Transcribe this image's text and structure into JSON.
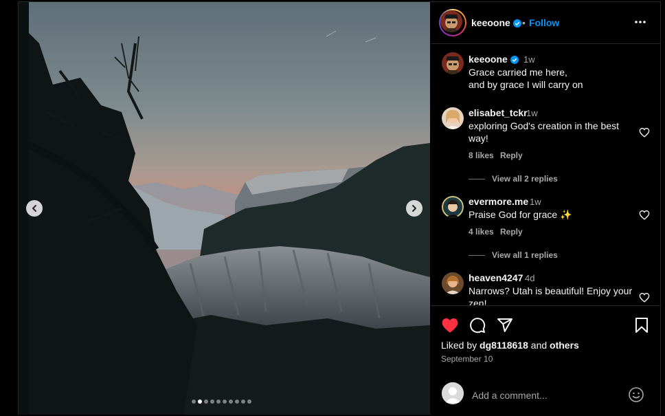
{
  "post": {
    "author": "keeoone",
    "follow_label": "Follow",
    "separator": "•",
    "image_count": 10,
    "image_index": 2
  },
  "caption": {
    "user": "keeoone",
    "time": "1w",
    "line1": "Grace carried me here,",
    "line2": "and by grace I will carry on"
  },
  "comments": [
    {
      "user": "elisabet_tckr",
      "time": "1w",
      "line1": "exploring God's creation in the best",
      "line2": "way!",
      "likes": "8 likes",
      "reply": "Reply",
      "view_replies": "View all 2 replies"
    },
    {
      "user": "evermore.me",
      "time": "1w",
      "line1": "Praise God for grace ✨",
      "likes": "4 likes",
      "reply": "Reply",
      "view_replies": "View all 1 replies"
    },
    {
      "user": "heaven4247",
      "time": "4d",
      "line1": "Narrows? Utah is beautiful! Enjoy your",
      "line2": "zen!"
    }
  ],
  "likes": {
    "prefix": "Liked by",
    "user": "dg8118618",
    "conj": "and",
    "others": "others"
  },
  "date": "September 10",
  "add_comment": {
    "placeholder": "Add a comment..."
  },
  "colors": {
    "accent": "#0095f6",
    "like": "#ff3040",
    "border": "#262626",
    "muted": "#a8a8a8"
  },
  "icons": [
    "chevron-left-icon",
    "chevron-right-icon",
    "more-icon",
    "verified-icon",
    "heart-icon",
    "comment-icon",
    "share-icon",
    "bookmark-icon",
    "emoji-icon"
  ]
}
